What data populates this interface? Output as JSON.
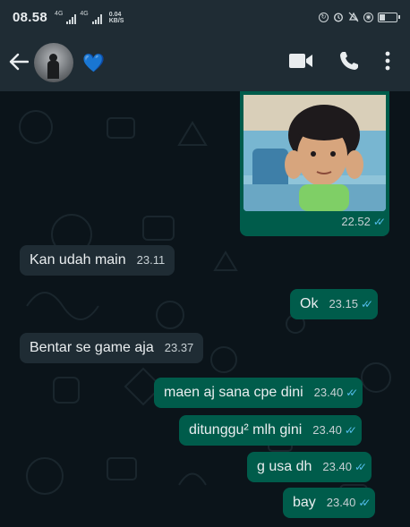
{
  "status_bar": {
    "time": "08.58",
    "network_tag_1": "4G",
    "network_tag_2": "4G",
    "speed_value": "0.04",
    "speed_unit": "KB/S",
    "battery_level": 0.35
  },
  "header": {
    "contact_name": "💙",
    "icons": [
      "back-arrow-icon",
      "video-call-icon",
      "voice-call-icon",
      "more-options-icon"
    ]
  },
  "messages": [
    {
      "direction": "outgoing",
      "type": "image",
      "time": "22.52",
      "ticks": "✓✓"
    },
    {
      "direction": "incoming",
      "text": "Kan udah main",
      "time": "23.11"
    },
    {
      "direction": "outgoing",
      "text": "Ok",
      "time": "23.15",
      "ticks": "✓✓"
    },
    {
      "direction": "incoming",
      "text": "Bentar se game aja",
      "time": "23.37"
    },
    {
      "direction": "outgoing",
      "text": "maen aj sana cpe dini",
      "time": "23.40",
      "ticks": "✓✓"
    },
    {
      "direction": "outgoing",
      "text": "ditunggu² mlh gini",
      "time": "23.40",
      "ticks": "✓✓"
    },
    {
      "direction": "outgoing",
      "text": "g usa dh",
      "time": "23.40",
      "ticks": "✓✓"
    },
    {
      "direction": "outgoing",
      "text": "bay",
      "time": "23.40",
      "ticks": "✓✓"
    }
  ],
  "colors": {
    "header_bg": "#1f2c34",
    "chat_bg": "#0b141a",
    "incoming_bubble": "#1f2c34",
    "outgoing_bubble": "#005c4b",
    "read_ticks": "#53bdeb"
  }
}
